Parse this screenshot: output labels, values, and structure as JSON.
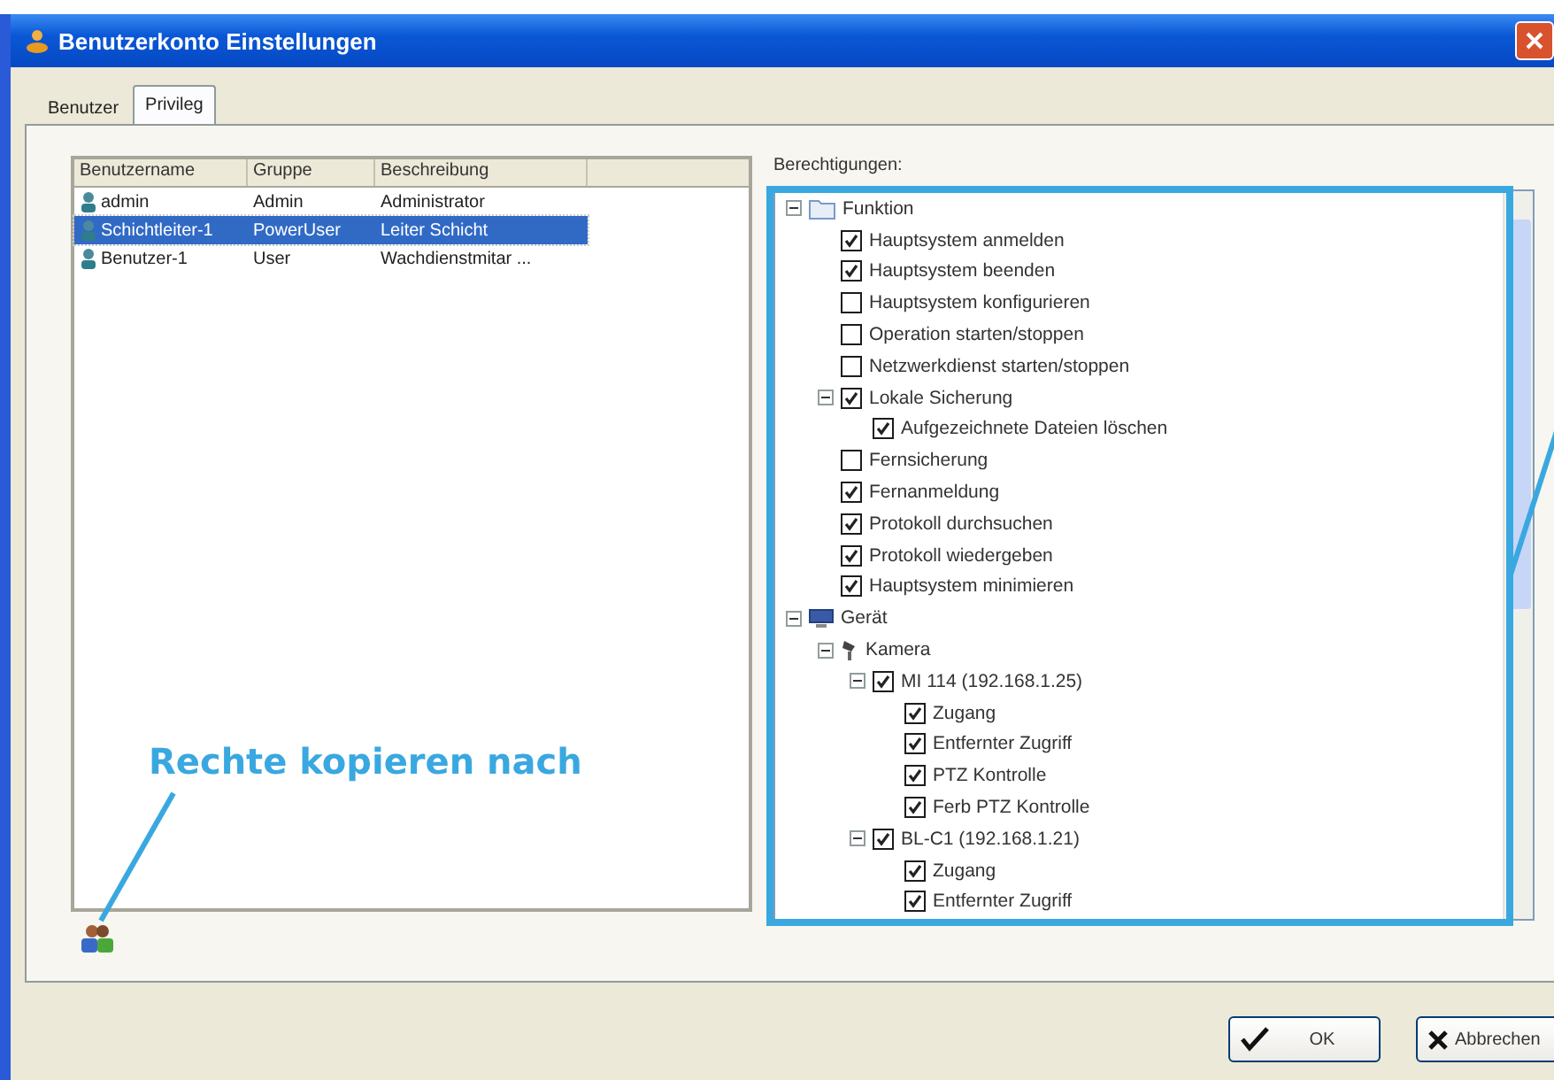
{
  "window": {
    "title": "Benutzerkonto Einstellungen"
  },
  "tabs": [
    {
      "label": "Benutzer",
      "selected": false
    },
    {
      "label": "Privileg",
      "selected": true
    }
  ],
  "user_table": {
    "columns": [
      "Benutzername",
      "Gruppe",
      "Beschreibung"
    ],
    "rows": [
      {
        "cells": [
          "admin",
          "Admin",
          "Administrator"
        ],
        "selected": false
      },
      {
        "cells": [
          "Schichtleiter-1",
          "PowerUser",
          "Leiter Schicht"
        ],
        "selected": true
      },
      {
        "cells": [
          "Benutzer-1",
          "User",
          "Wachdienstmitar ..."
        ],
        "selected": false
      }
    ]
  },
  "permissions": {
    "label": "Berechtigungen:",
    "tree": [
      {
        "label": "Funktion",
        "kind": "folder",
        "expanded": true,
        "children": [
          {
            "label": "Hauptsystem anmelden",
            "kind": "check",
            "checked": true
          },
          {
            "label": "Hauptsystem beenden",
            "kind": "check",
            "checked": true
          },
          {
            "label": "Hauptsystem konfigurieren",
            "kind": "check",
            "checked": false
          },
          {
            "label": "Operation starten/stoppen",
            "kind": "check",
            "checked": false
          },
          {
            "label": "Netzwerkdienst starten/stoppen",
            "kind": "check",
            "checked": false
          },
          {
            "label": "Lokale Sicherung",
            "kind": "check",
            "checked": true,
            "expanded": true,
            "children": [
              {
                "label": "Aufgezeichnete Dateien löschen",
                "kind": "check",
                "checked": true
              }
            ]
          },
          {
            "label": "Fernsicherung",
            "kind": "check",
            "checked": false
          },
          {
            "label": "Fernanmeldung",
            "kind": "check",
            "checked": true
          },
          {
            "label": "Protokoll durchsuchen",
            "kind": "check",
            "checked": true
          },
          {
            "label": "Protokoll wiedergeben",
            "kind": "check",
            "checked": true
          },
          {
            "label": "Hauptsystem minimieren",
            "kind": "check",
            "checked": true
          }
        ]
      },
      {
        "label": "Gerät",
        "kind": "device",
        "expanded": true,
        "children": [
          {
            "label": "Kamera",
            "kind": "camera",
            "expanded": true,
            "children": [
              {
                "label": "MI 114 (192.168.1.25)",
                "kind": "check",
                "checked": true,
                "expanded": true,
                "children": [
                  {
                    "label": "Zugang",
                    "kind": "check",
                    "checked": true
                  },
                  {
                    "label": "Entfernter Zugriff",
                    "kind": "check",
                    "checked": true
                  },
                  {
                    "label": "PTZ Kontrolle",
                    "kind": "check",
                    "checked": true
                  },
                  {
                    "label": "Ferb PTZ Kontrolle",
                    "kind": "check",
                    "checked": true
                  }
                ]
              },
              {
                "label": "BL-C1 (192.168.1.21)",
                "kind": "check",
                "checked": true,
                "expanded": true,
                "children": [
                  {
                    "label": "Zugang",
                    "kind": "check",
                    "checked": true
                  },
                  {
                    "label": "Entfernter Zugriff",
                    "kind": "check",
                    "checked": true
                  }
                ]
              }
            ]
          }
        ]
      }
    ]
  },
  "annotation": {
    "text": "Rechte kopieren nach"
  },
  "buttons": [
    {
      "label": "OK",
      "kind": "ok"
    },
    {
      "label": "Abbrechen",
      "kind": "cancel"
    }
  ]
}
